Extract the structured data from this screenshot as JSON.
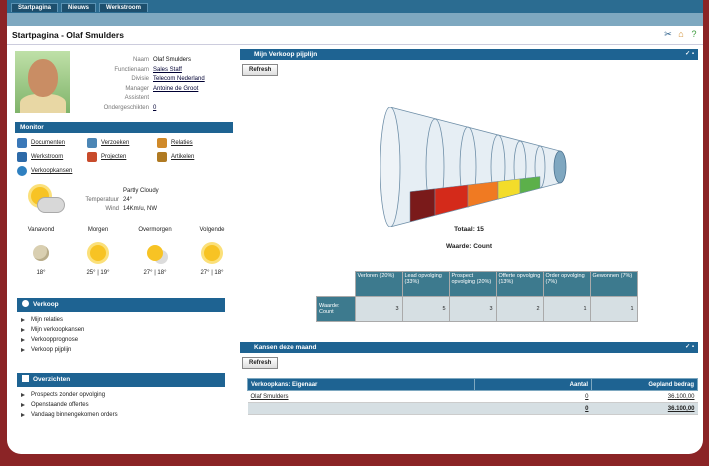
{
  "nav": {
    "tabs": [
      "Startpagina",
      "Nieuws",
      "Werkstroom"
    ]
  },
  "page": {
    "title": "Startpagina - Olaf Smulders"
  },
  "profile": {
    "fields": [
      {
        "key": "Naam",
        "value": "Olaf Smulders",
        "link": false
      },
      {
        "key": "Functienaam",
        "value": "Sales Staff",
        "link": true
      },
      {
        "key": "Divisie",
        "value": "Telecom Nederland",
        "link": true
      },
      {
        "key": "Manager",
        "value": "Antoine de Groot",
        "link": true
      },
      {
        "key": "Assistent",
        "value": "",
        "link": false
      },
      {
        "key": "Ondergeschikten",
        "value": "0",
        "link": true
      }
    ]
  },
  "monitor": {
    "title": "Monitor",
    "items": [
      {
        "label": "Documenten",
        "icon": "documents-icon",
        "color": "#3a78b8"
      },
      {
        "label": "Verzoeken",
        "icon": "requests-icon",
        "color": "#4c86b5"
      },
      {
        "label": "Relaties",
        "icon": "relations-icon",
        "color": "#d08a2a"
      },
      {
        "label": "Werkstroom",
        "icon": "workflow-icon",
        "color": "#2d6aa8"
      },
      {
        "label": "Projecten",
        "icon": "projects-icon",
        "color": "#c84b2b"
      },
      {
        "label": "Artikelen",
        "icon": "articles-icon",
        "color": "#b07a22"
      },
      {
        "label": "Verkoopkansen",
        "icon": "opportunities-icon",
        "color": "#2f80c0"
      }
    ]
  },
  "weather": {
    "now": {
      "condition": "Partly Cloudy",
      "temp_label": "Temperatuur",
      "temp": "24°",
      "wind_label": "Wind",
      "wind": "14Km/u, NW"
    },
    "forecast": [
      {
        "day": "Vanavond",
        "temp": "18°",
        "icon": "moon-icon"
      },
      {
        "day": "Morgen",
        "temp": "25° | 19°",
        "icon": "sun-icon"
      },
      {
        "day": "Overmorgen",
        "temp": "27° | 18°",
        "icon": "sun-haze-icon"
      },
      {
        "day": "Volgende",
        "temp": "27° | 18°",
        "icon": "sun-icon"
      }
    ]
  },
  "verkoop": {
    "title": "Verkoop",
    "items": [
      "Mijn relaties",
      "Mijn verkoopkansen",
      "Verkoopprognose",
      "Verkoop pijplijn"
    ]
  },
  "overzichten": {
    "title": "Overzichten",
    "items": [
      "Prospects zonder opvolging",
      "Openstaande offertes",
      "Vandaag binnengekomen orders"
    ]
  },
  "pipeline": {
    "title": "Mijn Verkoop pijplijn",
    "refresh": "Refresh",
    "total": "Totaal: 15",
    "value_label": "Waarde: Count",
    "colors": [
      "#7a1a1a",
      "#d42a1a",
      "#f07a22",
      "#f3dc2a",
      "#5cb04a"
    ],
    "table": {
      "row_label": "Waarde: Count",
      "headers": [
        "Verloren (20%)",
        "Lead opvolging (33%)",
        "Prospect opvolging (20%)",
        "Offerte opvolging (13%)",
        "Order opvolging (7%)",
        "Gewonnen (7%)"
      ],
      "values": [
        "3",
        "5",
        "3",
        "2",
        "1",
        "1"
      ]
    }
  },
  "chart_data": {
    "type": "table",
    "categories": [
      "Verloren",
      "Lead opvolging",
      "Prospect opvolging",
      "Offerte opvolging",
      "Order opvolging",
      "Gewonnen"
    ],
    "values": [
      3,
      5,
      3,
      2,
      1,
      1
    ],
    "percentages": [
      "20%",
      "33%",
      "20%",
      "13%",
      "7%",
      "7%"
    ],
    "total": 15
  },
  "kansen": {
    "title": "Kansen deze maand",
    "refresh": "Refresh",
    "headers": [
      "Verkoopkans: Eigenaar",
      "Aantal",
      "Gepland bedrag"
    ],
    "rows": [
      {
        "owner": "Olaf Smulders",
        "count": "0",
        "amount": "36.100,00"
      }
    ],
    "total": {
      "count": "0",
      "amount": "36.100,00"
    }
  }
}
